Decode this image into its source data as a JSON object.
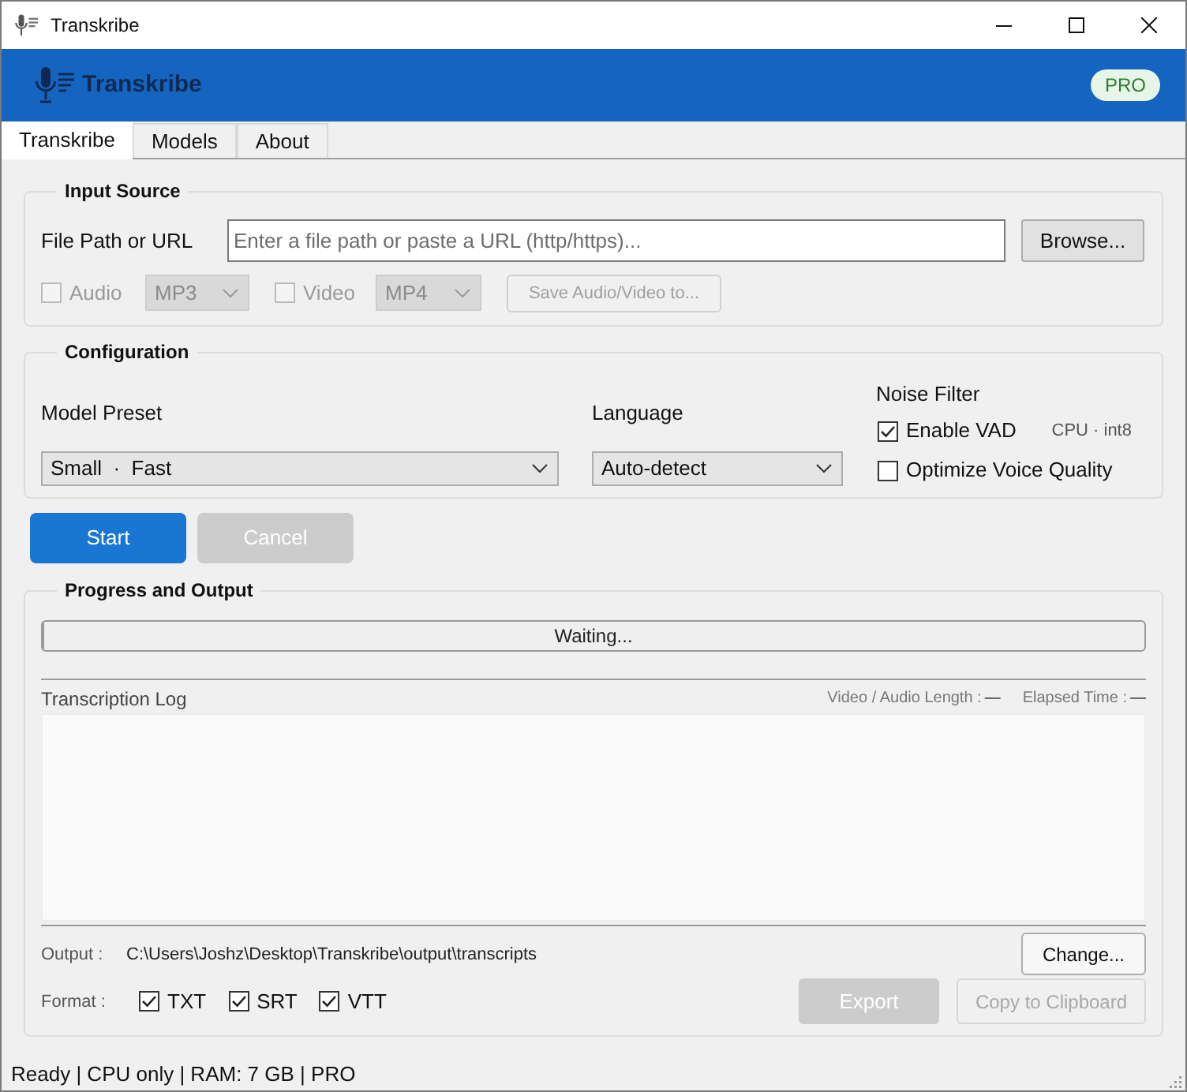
{
  "window": {
    "title": "Transkribe"
  },
  "header": {
    "title": "Transkribe",
    "badge": "PRO"
  },
  "tabs": [
    {
      "label": "Transkribe",
      "selected": true
    },
    {
      "label": "Models",
      "selected": false
    },
    {
      "label": "About",
      "selected": false
    }
  ],
  "input_source": {
    "title": "Input Source",
    "file": {
      "label": "File Path or URL",
      "placeholder": "Enter a file path or paste a URL (http/https)...",
      "button": "Browse..."
    },
    "options": [
      {
        "label": "Audio",
        "checked": false,
        "disabled": true,
        "format": "MP3"
      },
      {
        "label": "Video",
        "checked": false,
        "disabled": true,
        "format": "MP4"
      }
    ],
    "save_button": {
      "label": "Save Audio/Video to...",
      "disabled": true
    }
  },
  "configuration": {
    "title": "Configuration",
    "model_preset": {
      "label": "Model Preset",
      "value": "Small  ·  Fast"
    },
    "language": {
      "label": "Language",
      "value": "Auto-detect"
    },
    "noise_filter": {
      "title": "Noise Filter",
      "options": [
        {
          "label": "Enable VAD",
          "checked": true
        },
        {
          "label": "Optimize Voice Quality",
          "checked": false
        }
      ],
      "device_info": "CPU · int8"
    }
  },
  "actions": [
    {
      "label": "Start",
      "disabled": false
    },
    {
      "label": "Cancel",
      "disabled": true
    }
  ],
  "progress_output": {
    "title": "Progress and Output",
    "progress": {
      "text": "Waiting...",
      "level": 0
    },
    "log": {
      "title": "Transcription Log",
      "stats": [
        {
          "label": "Video / Audio Length :",
          "value": "—"
        },
        {
          "label": "Elapsed Time :",
          "value": "—"
        }
      ]
    },
    "output": {
      "label": "Output :",
      "path": "C:\\Users\\Joshz\\Desktop\\Transkribe\\output\\transcripts",
      "button": "Change..."
    },
    "format": {
      "label": "Format :",
      "options": [
        {
          "label": "TXT",
          "checked": true
        },
        {
          "label": "SRT",
          "checked": true
        },
        {
          "label": "VTT",
          "checked": true
        }
      ]
    },
    "buttons": [
      {
        "label": "Export",
        "kind": "filled",
        "disabled": true
      },
      {
        "label": "Copy to Clipboard",
        "kind": "outline",
        "disabled": true
      }
    ]
  },
  "status_bar": {
    "text": "Ready | CPU only | RAM: 7 GB | PRO"
  }
}
